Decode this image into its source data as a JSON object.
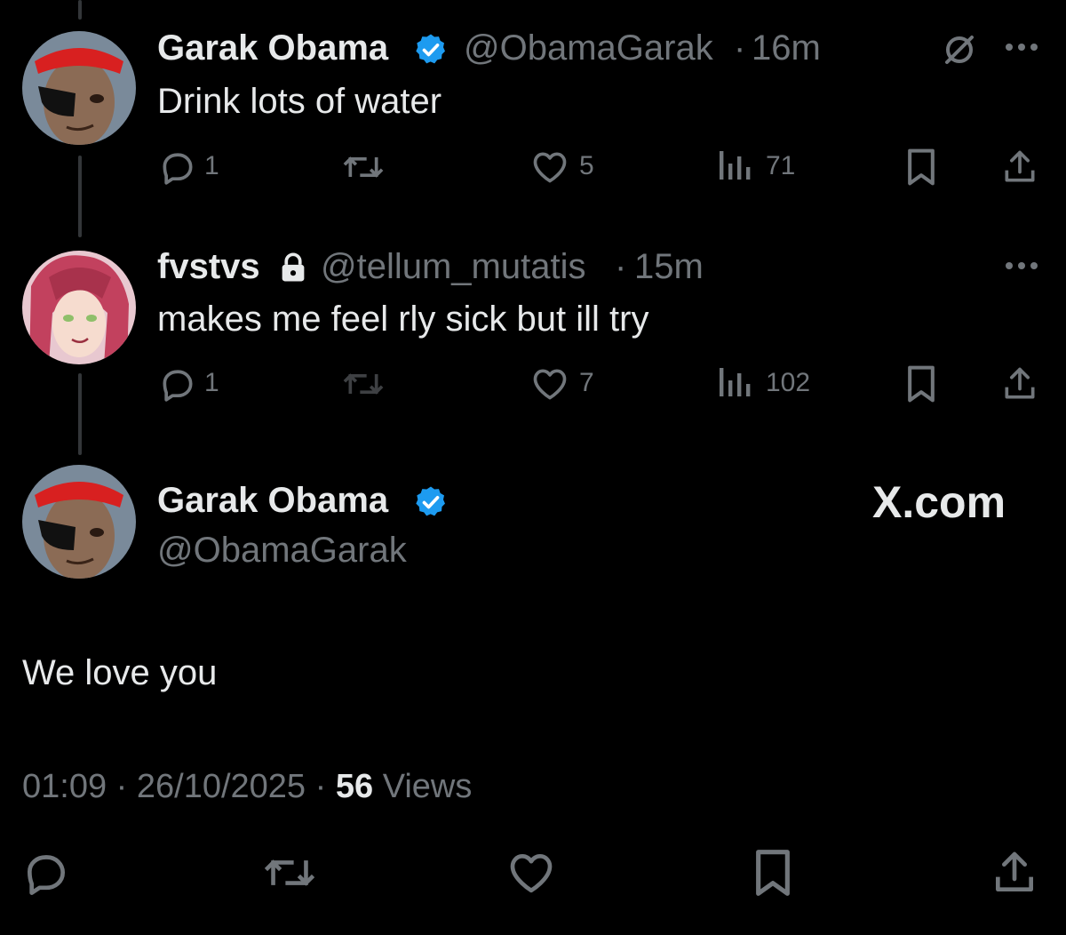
{
  "thread": [
    {
      "name": "Garak Obama",
      "handle": "@ObamaGarak",
      "sep": "·",
      "time": "16m",
      "text": "Drink lots of water",
      "replies": "1",
      "reposts": "",
      "likes": "5",
      "views": "71"
    },
    {
      "name": "fvstvs",
      "handle": "@tellum_mutatis",
      "sep": "·",
      "time": "15m",
      "text": "makes me feel rly sick but ill try",
      "replies": "1",
      "reposts": "",
      "likes": "7",
      "views": "102"
    }
  ],
  "main": {
    "name": "Garak Obama",
    "handle": "@ObamaGarak",
    "watermark": "X.com",
    "text": "We love you",
    "time": "01:09",
    "sep": "·",
    "date": "26/10/2025",
    "views_count": "56",
    "views_label": "Views"
  },
  "colors": {
    "background": "#000000",
    "text": "#e7e9ea",
    "muted": "#71767b",
    "verified": "#1d9bf0",
    "thread_line": "#333639"
  },
  "icons": [
    "verified-badge-icon",
    "grok-icon",
    "more-icon",
    "lock-icon",
    "reply-icon",
    "repost-icon",
    "like-icon",
    "views-icon",
    "bookmark-icon",
    "share-icon"
  ]
}
